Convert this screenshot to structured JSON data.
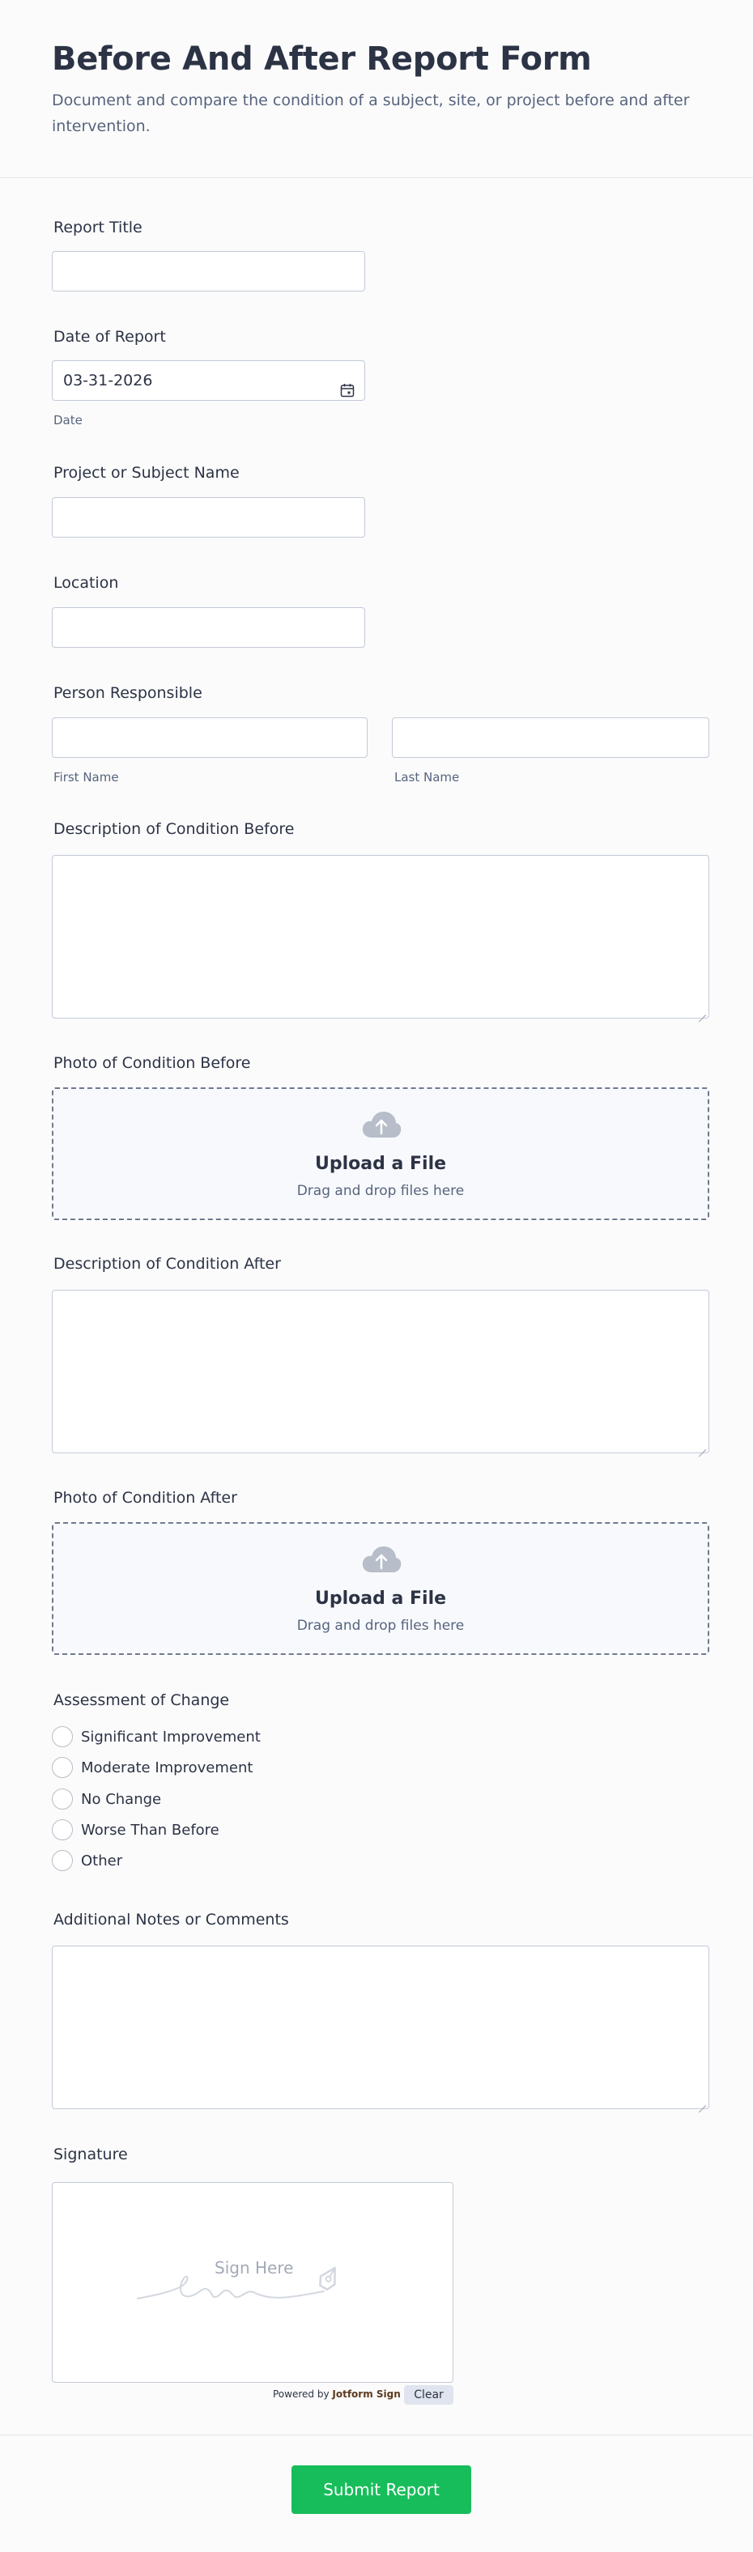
{
  "form": {
    "title": "Before And After Report Form",
    "description": "Document and compare the condition of a subject, site, or project before and after intervention."
  },
  "fields": {
    "report_title": {
      "label": "Report Title",
      "value": ""
    },
    "date_of_report": {
      "label": "Date of Report",
      "value": "03-31-2026",
      "sublabel": "Date",
      "icon": "calendar-icon"
    },
    "project_name": {
      "label": "Project or Subject Name",
      "value": ""
    },
    "location": {
      "label": "Location",
      "value": ""
    },
    "person_responsible": {
      "label": "Person Responsible",
      "first_name_sublabel": "First Name",
      "last_name_sublabel": "Last Name",
      "first_name_value": "",
      "last_name_value": ""
    },
    "description_before": {
      "label": "Description of Condition Before",
      "value": ""
    },
    "photo_before": {
      "label": "Photo of Condition Before",
      "upload_title": "Upload a File",
      "upload_sub": "Drag and drop files here",
      "icon": "cloud-upload-icon"
    },
    "description_after": {
      "label": "Description of Condition After",
      "value": ""
    },
    "photo_after": {
      "label": "Photo of Condition After",
      "upload_title": "Upload a File",
      "upload_sub": "Drag and drop files here",
      "icon": "cloud-upload-icon"
    },
    "assessment": {
      "label": "Assessment of Change",
      "options": [
        "Significant Improvement",
        "Moderate Improvement",
        "No Change",
        "Worse Than Before",
        "Other"
      ]
    },
    "notes": {
      "label": "Additional Notes or Comments",
      "value": ""
    },
    "signature": {
      "label": "Signature",
      "placeholder": "Sign Here",
      "powered_by": "Powered by",
      "brand": "Jotform Sign",
      "clear_label": "Clear"
    }
  },
  "submit": {
    "label": "Submit Report"
  },
  "colors": {
    "accent": "#18bd5b",
    "text": "#2c3345",
    "muted": "#57647e",
    "border": "#c3cad8"
  }
}
